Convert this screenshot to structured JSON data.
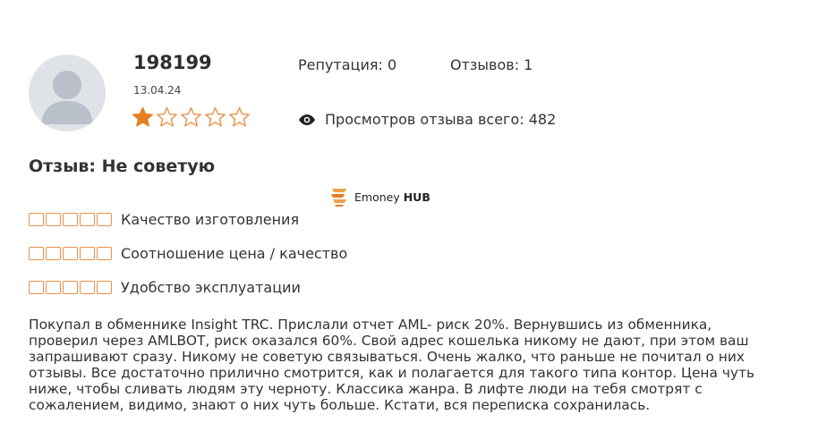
{
  "user": {
    "name": "198199",
    "date": "13.04.24",
    "rating": 1,
    "rating_max": 5
  },
  "stats": {
    "reputation": "Репутация: 0",
    "reviews": "Отзывов: 1",
    "views": "Просмотров отзыва всего: 482"
  },
  "review": {
    "title": "Отзыв: Не советую",
    "body_lines": [
      "Покупал в обменнике Insight TRC. Прислали отчет AML- риск 20%. Вернувшись из обменника,",
      "проверил через AMLBOT, риск оказался 60%. Свой адрес кошелька никому не дают, при этом ваш",
      "запрашивают сразу. Никому не советую связываться. Очень жалко, что раньше не почитал о них",
      "отзывы. Все достаточно прилично смотрится, как и полагается для такого типа контор. Цена чуть",
      "ниже, чтобы сливать людям эту черноту. Классика жанра. В лифте люди на тебя смотрят с",
      "сожалением, видимо, знают о них чуть больше. Кстати, вся переписка сохранилась."
    ]
  },
  "criteria": [
    {
      "label": "Качество изготовления",
      "score": 0,
      "max": 5
    },
    {
      "label": "Соотношение цена / качество",
      "score": 0,
      "max": 5
    },
    {
      "label": "Удобство эксплуатации",
      "score": 0,
      "max": 5
    }
  ],
  "watermark": {
    "brand_plain": "Emoney ",
    "brand_bold": "HUB"
  },
  "colors": {
    "star_filled": "#e67e22",
    "star_empty_stroke": "#e8914a",
    "box_stroke": "#e8914a",
    "avatar_bg": "#dfe3e8",
    "avatar_fg": "#b9c0c9"
  }
}
